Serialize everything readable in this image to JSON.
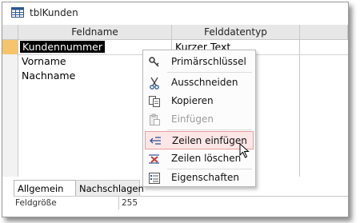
{
  "window": {
    "title": "tblKunden"
  },
  "grid": {
    "columns": [
      "Feldname",
      "Felddatentyp"
    ],
    "rows": [
      {
        "name": "Kundennummer",
        "type": "Kurzer Text"
      },
      {
        "name": "Vorname",
        "type": ""
      },
      {
        "name": "Nachname",
        "type": ""
      }
    ]
  },
  "tabs": [
    "Allgemein",
    "Nachschlagen"
  ],
  "properties": [
    {
      "label": "Feldgröße",
      "value": "255"
    }
  ],
  "context_menu": {
    "items": [
      {
        "label": "Primärschlüssel",
        "icon": "key-icon"
      },
      {
        "label": "Ausschneiden",
        "icon": "scissors-icon"
      },
      {
        "label": "Kopieren",
        "icon": "copy-icon"
      },
      {
        "label": "Einfügen",
        "icon": "paste-icon"
      },
      {
        "label": "Zeilen einfügen",
        "icon": "insert-rows-icon"
      },
      {
        "label": "Zeilen löschen",
        "icon": "delete-rows-icon"
      },
      {
        "label": "Eigenschaften",
        "icon": "properties-icon"
      }
    ]
  }
}
